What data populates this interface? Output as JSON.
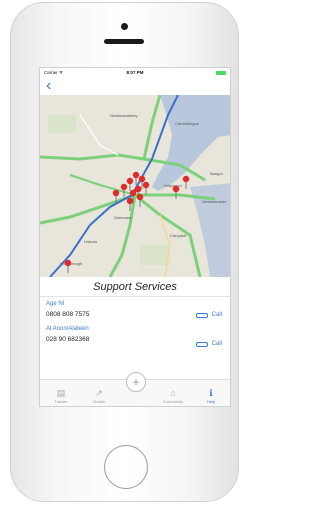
{
  "status": {
    "carrier": "Carrier ᯤ",
    "time": "8:07 PM"
  },
  "nav": {
    "back_icon": "chevron-left-icon"
  },
  "map": {
    "places": [
      "Newtownabbey",
      "Carrickfergus",
      "Holywood",
      "Bangor",
      "Newtownards",
      "Lisburn",
      "Carryduff",
      "Dunmurry",
      "Hillsborough"
    ]
  },
  "section_title": "Support Services",
  "services": [
    {
      "name": "Age NI",
      "phone": "0808 808 7575",
      "call_label": "Call"
    },
    {
      "name": "Al Anon/Alateen",
      "phone": "028 90 682368",
      "call_label": "Call"
    }
  ],
  "tabs": [
    {
      "label": "Tracker",
      "icon": "calendar-icon"
    },
    {
      "label": "Charter",
      "icon": "chart-icon"
    },
    {
      "label": "",
      "icon": "plus-icon"
    },
    {
      "label": "Community",
      "icon": "community-icon"
    },
    {
      "label": "Help",
      "icon": "info-icon"
    }
  ],
  "colors": {
    "accent": "#3a7bd5",
    "pin": "#e02b2b",
    "water": "#b9c7dd",
    "road_main": "#7cd07a",
    "motorway": "#3b6fc9"
  }
}
